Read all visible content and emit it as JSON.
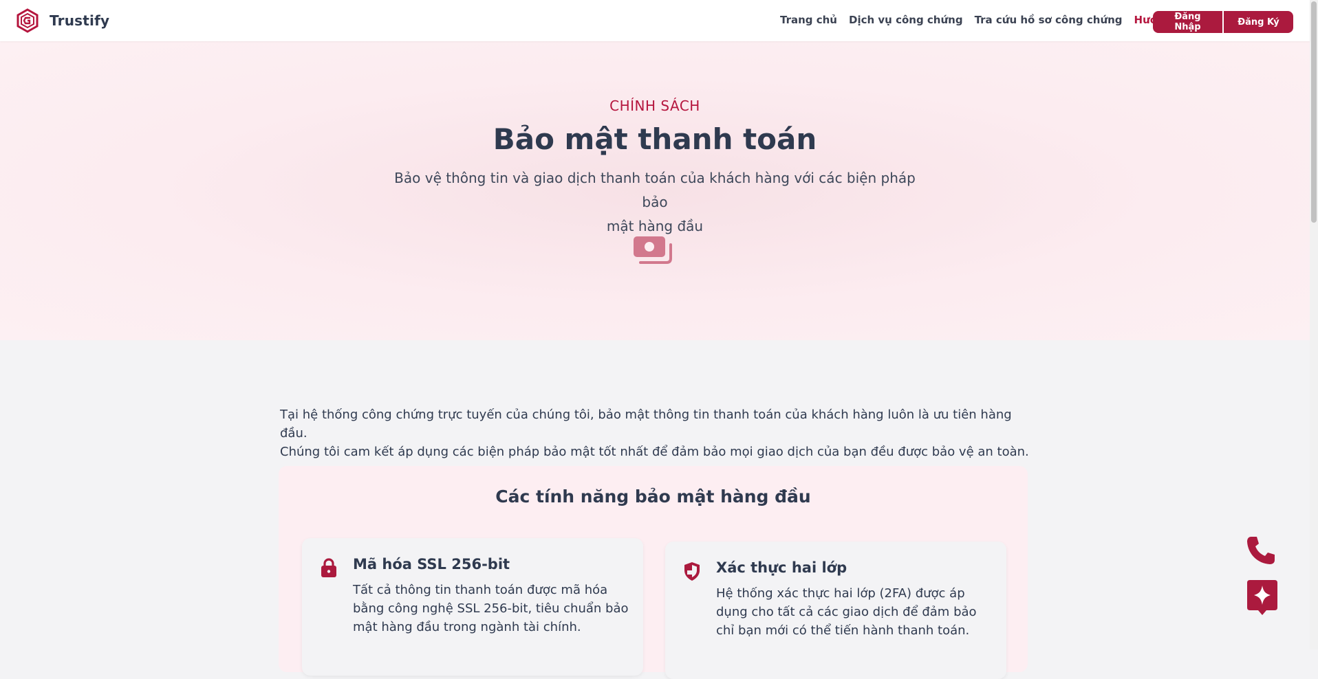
{
  "brand": {
    "name": "Trustify",
    "logo_icon": "trustify-logo-icon"
  },
  "nav": {
    "items": [
      {
        "label": "Trang chủ"
      },
      {
        "label": "Dịch vụ công chứng"
      },
      {
        "label": "Tra cứu hồ sơ công chứng"
      },
      {
        "label": "Hướng dẫn",
        "active": true
      }
    ]
  },
  "auth": {
    "login_label": "Đăng Nhập",
    "register_label": "Đăng Ký"
  },
  "hero": {
    "eyebrow": "CHÍNH SÁCH",
    "title": "Bảo mật thanh toán",
    "subtitle_line1": "Bảo vệ thông tin và giao dịch thanh toán của khách hàng với các biện pháp bảo",
    "subtitle_line2": "mật hàng đầu",
    "icon": "money-bill-icon"
  },
  "intro": {
    "line1": "Tại hệ thống công chứng trực tuyến của chúng tôi, bảo mật thông tin thanh toán của khách hàng luôn là ưu tiên hàng đầu.",
    "line2": "Chúng tôi cam kết áp dụng các biện pháp bảo mật tốt nhất để đảm bảo mọi giao dịch của bạn đều được bảo vệ an toàn."
  },
  "features": {
    "title": "Các tính năng bảo mật hàng đầu",
    "cards": [
      {
        "icon": "lock-icon",
        "title": "Mã hóa SSL 256-bit",
        "desc_lines": [
          "Tất cả thông tin thanh toán được mã hóa",
          "bằng công nghệ SSL 256-bit, tiêu chuẩn bảo",
          "mật hàng đầu trong ngành tài chính."
        ]
      },
      {
        "icon": "shield-icon",
        "title": "Xác thực hai lớp",
        "desc_lines": [
          "Hệ thống xác thực hai lớp (2FA) được áp",
          "dụng cho tất cả các giao dịch để đảm bảo",
          "chỉ bạn mới có thể tiến hành thanh toán."
        ]
      }
    ]
  },
  "floating": {
    "phone_icon": "phone-icon",
    "assistant_icon": "sparkle-chat-icon"
  },
  "colors": {
    "accent": "#ab1a3e",
    "hero_bg": "#fcecf0",
    "text": "#2f3a4f"
  }
}
